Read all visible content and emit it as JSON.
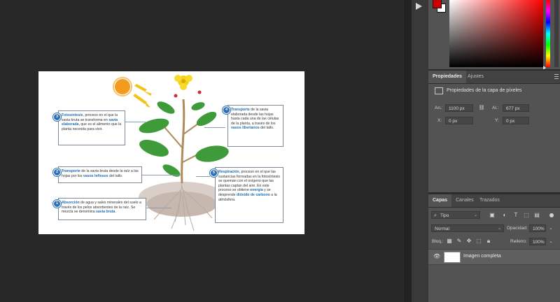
{
  "properties_panel": {
    "tabs": [
      "Propiedades",
      "Ajustes"
    ],
    "section_title": "Propiedades de la capa de píxeles",
    "w_label": "An.:",
    "w_value": "1100 px",
    "h_label": "Al.:",
    "h_value": "677 px",
    "x_label": "X:",
    "x_value": "0 px",
    "y_label": "Y:",
    "y_value": "0 px"
  },
  "layers_panel": {
    "tabs": [
      "Capas",
      "Canales",
      "Trazados"
    ],
    "filter_label": "Tipo",
    "blend_mode": "Normal",
    "opacity_label": "Opacidad:",
    "opacity_value": "100%",
    "lock_label": "Bloq.:",
    "fill_label": "Relleno:",
    "fill_value": "100%",
    "layers": [
      {
        "name": "Imagen completa",
        "visible": true
      }
    ]
  },
  "colors": {
    "foreground": "#cc0000",
    "background": "#ffffff"
  },
  "diagram": {
    "callouts": [
      {
        "num": "3",
        "highlight": "Fotosíntesis",
        "text_a": ", proceso en el que la savia bruta se transforma en ",
        "highlight2": "savia elaborada",
        "text_b": ", que es el alimento que la planta necesita para vivir."
      },
      {
        "num": "2",
        "highlight": "Transporte",
        "text_a": " de la savia bruta desde la raíz a las hojas por los ",
        "highlight2": "vasos leñosos",
        "text_b": " del tallo."
      },
      {
        "num": "1",
        "highlight": "Absorción",
        "text_a": " de agua y sales minerales del suelo a través de los pelos absorbentes de la raíz. Se mezcla se denomina ",
        "highlight2": "savia bruta",
        "text_b": "."
      },
      {
        "num": "4",
        "highlight": "Transporte",
        "text_a": " de la savia elaborada desde las hojas hasta cada una de las células de la planta, a través de los ",
        "highlight2": "vasos liberianos",
        "text_b": " del tallo."
      },
      {
        "num": "5",
        "highlight": "Respiración",
        "text_a": ", proceso en el que las sustancias formadas en la fotosíntesis se queman con el oxígeno que las plantas captan del aire. En este proceso se obtiene ",
        "highlight2": "energía",
        "text_b": " y se desprende ",
        "highlight3": "dióxido de carbono",
        "text_c": " a la atmósfera."
      }
    ]
  }
}
